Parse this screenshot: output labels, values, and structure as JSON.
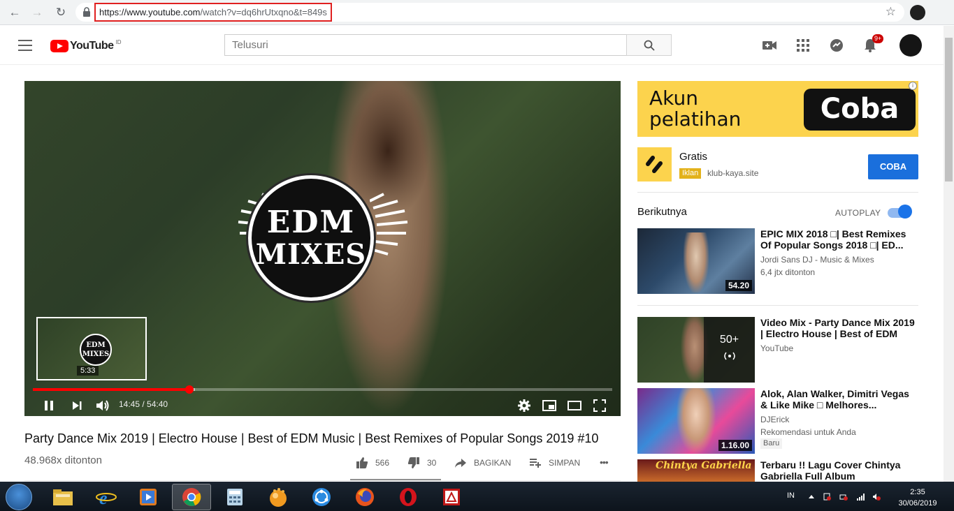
{
  "browser": {
    "url_host": "https://www.youtube.com",
    "url_path": "/watch?v=dq6hrUtxqno&t=849s"
  },
  "header": {
    "logo_text": "YouTube",
    "region": "ID",
    "search_placeholder": "Telusuri",
    "notification_count": "9+"
  },
  "player": {
    "logo_line1": "EDM",
    "logo_line2": "MIXES",
    "preview_logo": "EDM MIXES",
    "preview_time": "5:33",
    "time": "14:45 / 54:40",
    "progress_played": 0.27,
    "progress_buffered": 0.28
  },
  "video": {
    "title": "Party Dance Mix 2019 | Electro House | Best of EDM Music | Best Remixes of Popular Songs 2019 #10",
    "views": "48.968x ditonton",
    "likes": "566",
    "dislikes": "30",
    "share_label": "BAGIKAN",
    "save_label": "SIMPAN",
    "more_label": "•••"
  },
  "ad": {
    "banner_text_line1": "Akun",
    "banner_text_line2": "pelatihan",
    "banner_cta": "Coba",
    "name": "Gratis",
    "badge": "Iklan",
    "domain": "klub-kaya.site",
    "cta": "COBA",
    "info": "i"
  },
  "upnext": {
    "label": "Berikutnya",
    "autoplay_label": "AUTOPLAY",
    "autoplay_on": true
  },
  "recommendations": [
    {
      "title": "EPIC MIX 2018 □| Best Remixes Of Popular Songs 2018 □| ED...",
      "channel": "Jordi Sans DJ - Music & Mixes",
      "meta": "6,4 jtx ditonton",
      "duration": "54.20"
    },
    {
      "title": "Video Mix - Party Dance Mix 2019 | Electro House | Best of EDM Musi...",
      "channel": "YouTube",
      "mix_count": "50+"
    },
    {
      "title": "Alok, Alan Walker, Dimitri Vegas & Like Mike □ Melhores...",
      "channel": "DJErick",
      "meta": "Rekomendasi untuk Anda",
      "badge": "Baru",
      "duration": "1.16.00"
    },
    {
      "title": "Terbaru !! Lagu Cover Chintya Gabriella Full Album",
      "thumb_text": "Chintya Gabriella"
    }
  ],
  "taskbar": {
    "lang": "IN",
    "time": "2:35",
    "date": "30/06/2019"
  }
}
